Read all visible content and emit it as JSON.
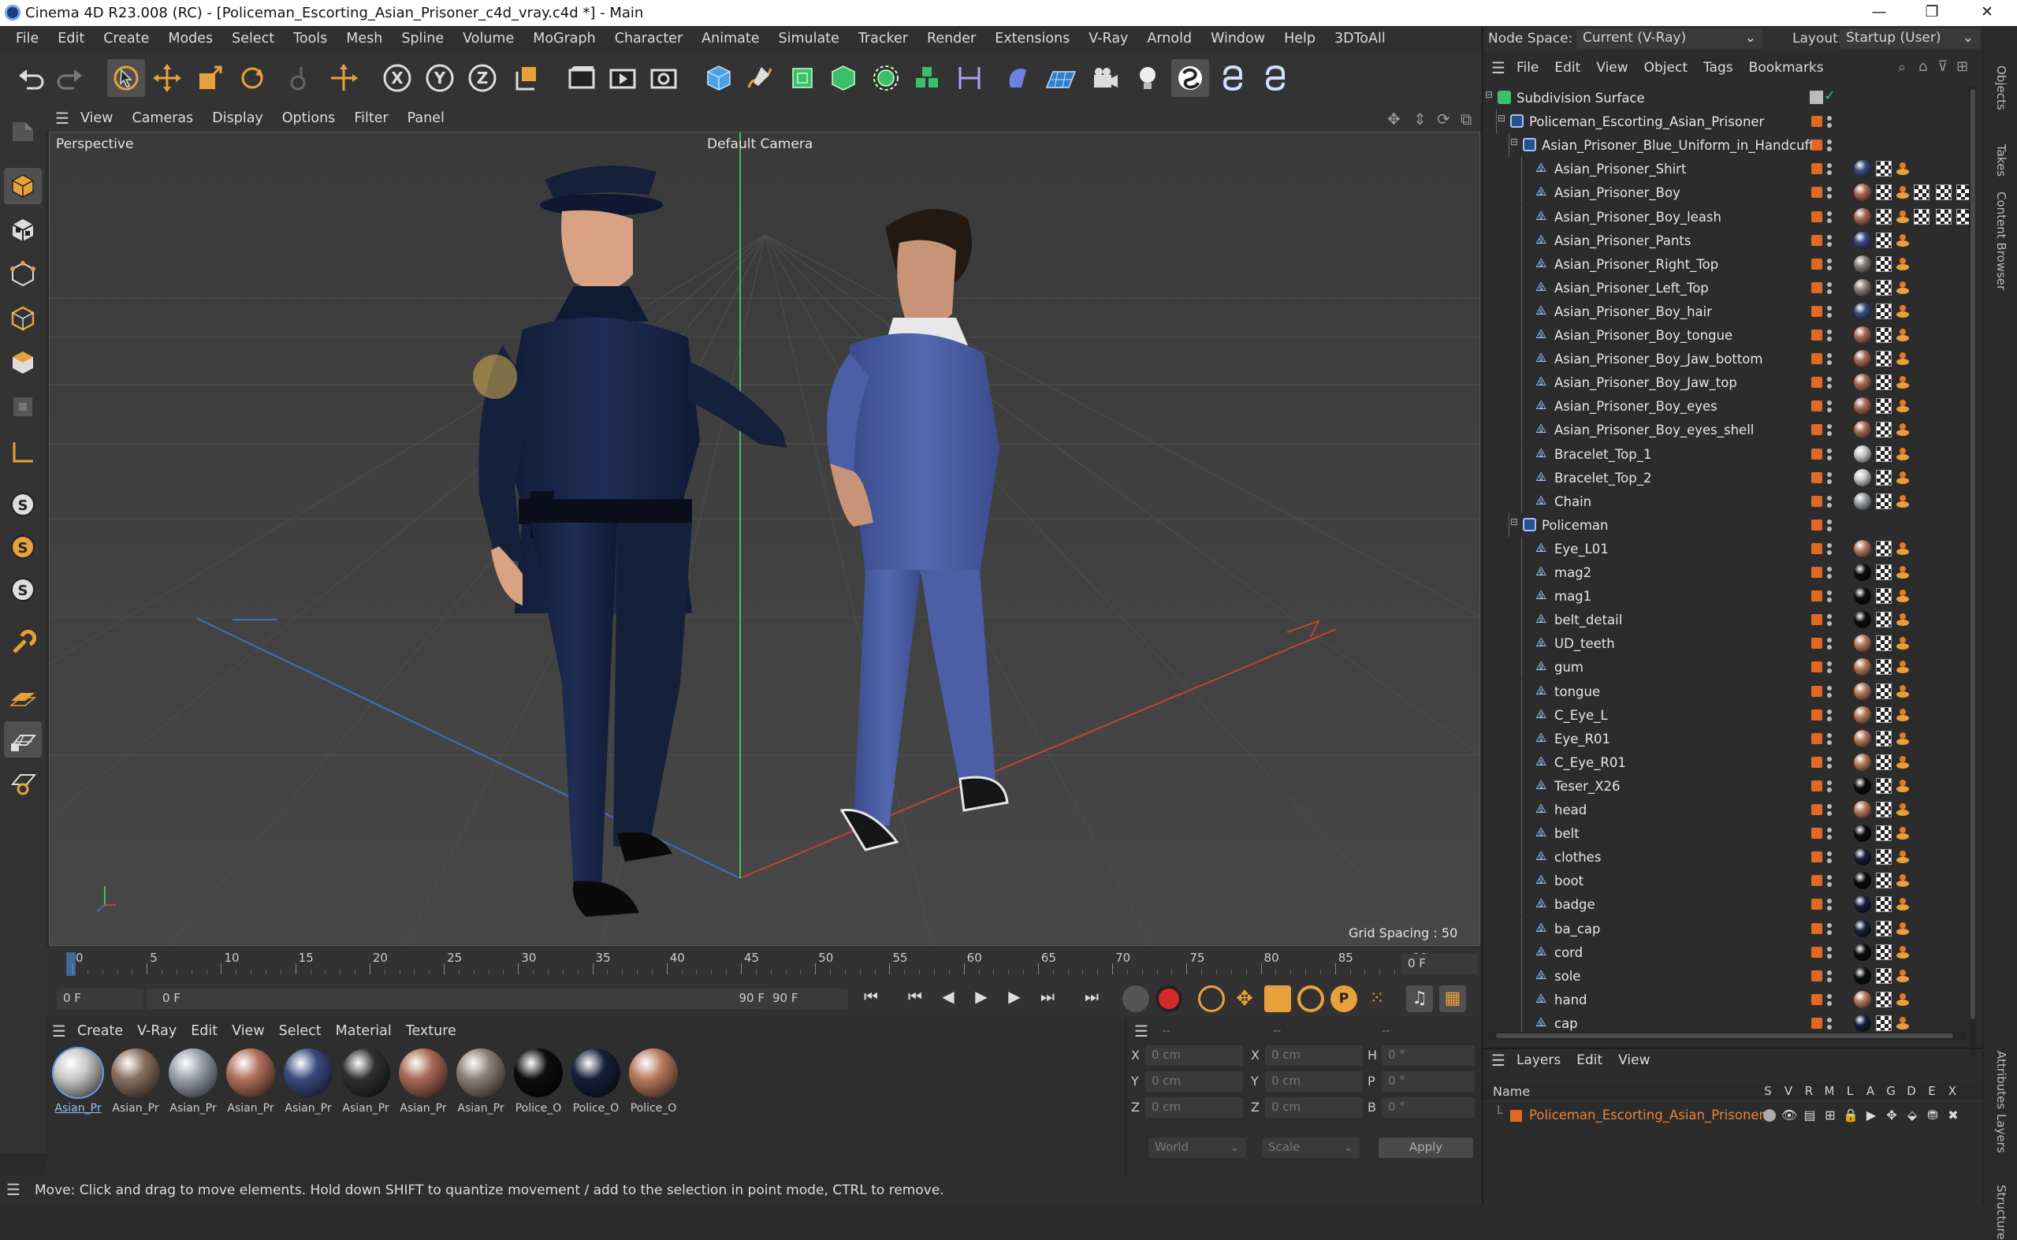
{
  "window": {
    "title": "Cinema 4D R23.008 (RC) - [Policeman_Escorting_Asian_Prisoner_c4d_vray.c4d *] - Main"
  },
  "menu": [
    "File",
    "Edit",
    "Create",
    "Modes",
    "Select",
    "Tools",
    "Mesh",
    "Spline",
    "Volume",
    "MoGraph",
    "Character",
    "Animate",
    "Simulate",
    "Tracker",
    "Render",
    "Extensions",
    "V-Ray",
    "Arnold",
    "Window",
    "Help",
    "3DToAll"
  ],
  "node_space": {
    "label": "Node Space:",
    "value": "Current (V-Ray)"
  },
  "layout": {
    "label": "Layout:",
    "value": "Startup (User)"
  },
  "viewport": {
    "menu": [
      "View",
      "Cameras",
      "Display",
      "Options",
      "Filter",
      "Panel"
    ],
    "view_label": "Perspective",
    "camera_label": "Default Camera",
    "grid_spacing": "Grid Spacing : 50 cm"
  },
  "timeline": {
    "ticks": [
      "0",
      "5",
      "10",
      "15",
      "20",
      "25",
      "30",
      "35",
      "40",
      "45",
      "50",
      "55",
      "60",
      "65",
      "70",
      "75",
      "80",
      "85",
      "90"
    ],
    "current_frame": "0 F",
    "end_frame_field": "90 F",
    "start_field": "0 F",
    "range_start": "0 F",
    "range_end": "90 F",
    "range_end2": "90 F"
  },
  "material_menu": [
    "Create",
    "V-Ray",
    "Edit",
    "View",
    "Select",
    "Material",
    "Texture"
  ],
  "materials": [
    {
      "label": "Asian_Pr",
      "color": "#c8c8c8",
      "selected": true
    },
    {
      "label": "Asian_Pr",
      "color": "#8a7060"
    },
    {
      "label": "Asian_Pr",
      "color": "#9aa0a8"
    },
    {
      "label": "Asian_Pr",
      "color": "#b0705a"
    },
    {
      "label": "Asian_Pr",
      "color": "#3a4c80"
    },
    {
      "label": "Asian_Pr",
      "color": "#303030"
    },
    {
      "label": "Asian_Pr",
      "color": "#a86a55"
    },
    {
      "label": "Asian_Pr",
      "color": "#8a8078"
    },
    {
      "label": "Police_O",
      "color": "#0d0d0d"
    },
    {
      "label": "Police_O",
      "color": "#15203a"
    },
    {
      "label": "Police_O",
      "color": "#b87a5e"
    }
  ],
  "coords": {
    "header1": "--",
    "header2": "--",
    "header3": "--",
    "rows": [
      {
        "a": "X",
        "av": "0 cm",
        "b": "X",
        "bv": "0 cm",
        "c": "H",
        "cv": "0 °"
      },
      {
        "a": "Y",
        "av": "0 cm",
        "b": "Y",
        "bv": "0 cm",
        "c": "P",
        "cv": "0 °"
      },
      {
        "a": "Z",
        "av": "0 cm",
        "b": "Z",
        "bv": "0 cm",
        "c": "B",
        "cv": "0 °"
      }
    ],
    "world": "World",
    "scale": "Scale",
    "apply": "Apply"
  },
  "status": "Move: Click and drag to move elements. Hold down SHIFT to quantize movement / add to the selection in point mode, CTRL to remove.",
  "objects_menu": [
    "File",
    "Edit",
    "View",
    "Object",
    "Tags",
    "Bookmarks"
  ],
  "objects": [
    {
      "name": "Subdivision Surface",
      "indent": 0,
      "type": "subd",
      "tags": "check"
    },
    {
      "name": "Policeman_Escorting_Asian_Prisoner",
      "indent": 1,
      "type": "null"
    },
    {
      "name": "Asian_Prisoner_Blue_Uniform_in_Handcuffs",
      "indent": 2,
      "type": "null"
    },
    {
      "name": "Asian_Prisoner_Shirt",
      "indent": 3,
      "type": "mesh",
      "ball": "#3a4c80"
    },
    {
      "name": "Asian_Prisoner_Boy",
      "indent": 3,
      "type": "mesh",
      "ball": "#a86a55",
      "extra": true
    },
    {
      "name": "Asian_Prisoner_Boy_leash",
      "indent": 3,
      "type": "mesh",
      "ball": "#a86a55",
      "extra": true
    },
    {
      "name": "Asian_Prisoner_Pants",
      "indent": 3,
      "type": "mesh",
      "ball": "#3a4c80"
    },
    {
      "name": "Asian_Prisoner_Right_Top",
      "indent": 3,
      "type": "mesh",
      "ball": "#8a8078"
    },
    {
      "name": "Asian_Prisoner_Left_Top",
      "indent": 3,
      "type": "mesh",
      "ball": "#8a8078"
    },
    {
      "name": "Asian_Prisoner_Boy_hair",
      "indent": 3,
      "type": "mesh",
      "ball": "#3a4c80"
    },
    {
      "name": "Asian_Prisoner_Boy_tongue",
      "indent": 3,
      "type": "mesh",
      "ball": "#a86a55"
    },
    {
      "name": "Asian_Prisoner_Boy_Jaw_bottom",
      "indent": 3,
      "type": "mesh",
      "ball": "#a86a55"
    },
    {
      "name": "Asian_Prisoner_Boy_Jaw_top",
      "indent": 3,
      "type": "mesh",
      "ball": "#a86a55"
    },
    {
      "name": "Asian_Prisoner_Boy_eyes",
      "indent": 3,
      "type": "mesh",
      "ball": "#a86a55"
    },
    {
      "name": "Asian_Prisoner_Boy_eyes_shell",
      "indent": 3,
      "type": "mesh",
      "ball": "#a86a55"
    },
    {
      "name": "Bracelet_Top_1",
      "indent": 3,
      "type": "mesh",
      "ball": "#c8c8c8"
    },
    {
      "name": "Bracelet_Top_2",
      "indent": 3,
      "type": "mesh",
      "ball": "#c8c8c8"
    },
    {
      "name": "Chain",
      "indent": 3,
      "type": "mesh",
      "ball": "#9aa0a8"
    },
    {
      "name": "Policeman",
      "indent": 2,
      "type": "null"
    },
    {
      "name": "Eye_L01",
      "indent": 3,
      "type": "mesh",
      "ball": "#b87a5e"
    },
    {
      "name": "mag2",
      "indent": 3,
      "type": "mesh",
      "ball": "#0d0d0d"
    },
    {
      "name": "mag1",
      "indent": 3,
      "type": "mesh",
      "ball": "#0d0d0d"
    },
    {
      "name": "belt_detail",
      "indent": 3,
      "type": "mesh",
      "ball": "#0d0d0d"
    },
    {
      "name": "UD_teeth",
      "indent": 3,
      "type": "mesh",
      "ball": "#b87a5e"
    },
    {
      "name": "gum",
      "indent": 3,
      "type": "mesh",
      "ball": "#b87a5e"
    },
    {
      "name": "tongue",
      "indent": 3,
      "type": "mesh",
      "ball": "#b87a5e"
    },
    {
      "name": "C_Eye_L",
      "indent": 3,
      "type": "mesh",
      "ball": "#b87a5e"
    },
    {
      "name": "Eye_R01",
      "indent": 3,
      "type": "mesh",
      "ball": "#b87a5e"
    },
    {
      "name": "C_Eye_R01",
      "indent": 3,
      "type": "mesh",
      "ball": "#b87a5e"
    },
    {
      "name": "Teser_X26",
      "indent": 3,
      "type": "mesh",
      "ball": "#0d0d0d"
    },
    {
      "name": "head",
      "indent": 3,
      "type": "mesh",
      "ball": "#b87a5e"
    },
    {
      "name": "belt",
      "indent": 3,
      "type": "mesh",
      "ball": "#0d0d0d"
    },
    {
      "name": "clothes",
      "indent": 3,
      "type": "mesh",
      "ball": "#15203a"
    },
    {
      "name": "boot",
      "indent": 3,
      "type": "mesh",
      "ball": "#0d0d0d"
    },
    {
      "name": "badge",
      "indent": 3,
      "type": "mesh",
      "ball": "#15203a"
    },
    {
      "name": "ba_cap",
      "indent": 3,
      "type": "mesh",
      "ball": "#15203a"
    },
    {
      "name": "cord",
      "indent": 3,
      "type": "mesh",
      "ball": "#0d0d0d"
    },
    {
      "name": "sole",
      "indent": 3,
      "type": "mesh",
      "ball": "#0d0d0d"
    },
    {
      "name": "hand",
      "indent": 3,
      "type": "mesh",
      "ball": "#b87a5e"
    },
    {
      "name": "cap",
      "indent": 3,
      "type": "mesh",
      "ball": "#15203a"
    }
  ],
  "layers_menu": [
    "Layers",
    "Edit",
    "View"
  ],
  "layers": {
    "col_name": "Name",
    "cols": [
      "S",
      "V",
      "R",
      "M",
      "L",
      "A",
      "G",
      "D",
      "E",
      "X"
    ],
    "row": "Policeman_Escorting_Asian_Prisoner"
  },
  "side_tabs": [
    "Objects",
    "Takes",
    "Content Browser",
    "Attributes",
    "Layers",
    "Structure"
  ]
}
